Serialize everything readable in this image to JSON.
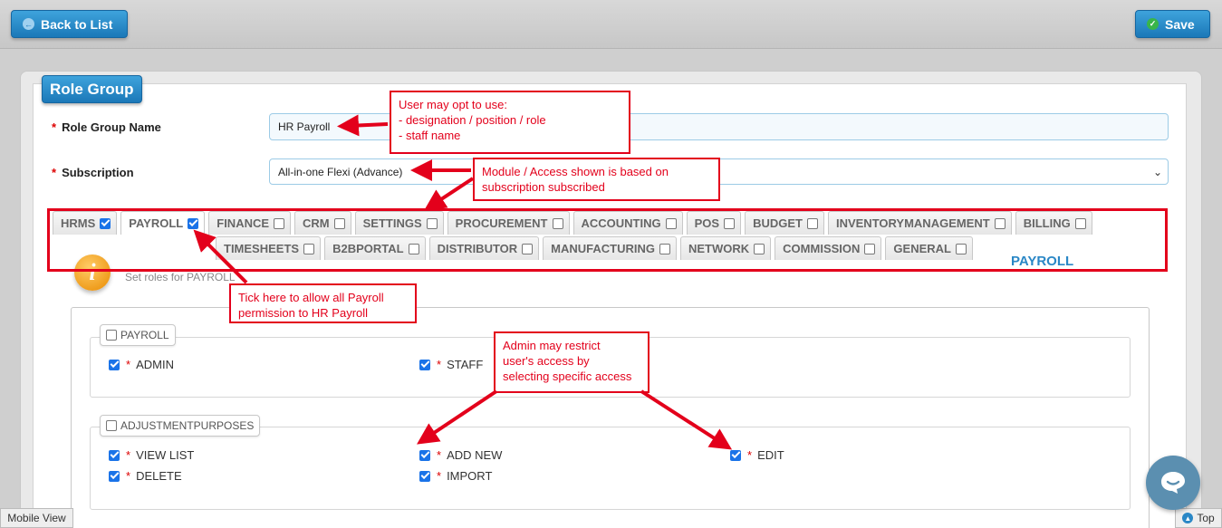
{
  "toolbar": {
    "back_label": "Back to List",
    "save_label": "Save"
  },
  "panel": {
    "title": "Role Group",
    "name_label": "Role Group Name",
    "name_value": "HR Payroll",
    "subscription_label": "Subscription",
    "subscription_value": "All-in-one Flexi (Advance)"
  },
  "tabs_row1": [
    {
      "label": "HRMS",
      "checked": true
    },
    {
      "label": "PAYROLL",
      "checked": true
    },
    {
      "label": "FINANCE",
      "checked": false
    },
    {
      "label": "CRM",
      "checked": false
    },
    {
      "label": "SETTINGS",
      "checked": false
    },
    {
      "label": "PROCUREMENT",
      "checked": false
    },
    {
      "label": "ACCOUNTING",
      "checked": false
    },
    {
      "label": "POS",
      "checked": false
    },
    {
      "label": "BUDGET",
      "checked": false
    },
    {
      "label": "INVENTORYMANAGEMENT",
      "checked": false
    },
    {
      "label": "BILLING",
      "checked": false
    }
  ],
  "tabs_row2": [
    {
      "label": "TIMESHEETS",
      "checked": false
    },
    {
      "label": "B2BPORTAL",
      "checked": false
    },
    {
      "label": "DISTRIBUTOR",
      "checked": false
    },
    {
      "label": "MANUFACTURING",
      "checked": false
    },
    {
      "label": "NETWORK",
      "checked": false
    },
    {
      "label": "COMMISSION",
      "checked": false
    },
    {
      "label": "GENERAL",
      "checked": false
    }
  ],
  "active_tab_title": "PAYROLL",
  "info_text": "Set roles for PAYROLL",
  "groups": [
    {
      "label": "PAYROLL",
      "items": [
        {
          "label": "ADMIN",
          "checked": true
        },
        {
          "label": "STAFF",
          "checked": true
        }
      ]
    },
    {
      "label": "ADJUSTMENTPURPOSES",
      "items": [
        {
          "label": "VIEW LIST",
          "checked": true
        },
        {
          "label": "ADD NEW",
          "checked": true
        },
        {
          "label": "EDIT",
          "checked": true
        },
        {
          "label": "DELETE",
          "checked": true
        },
        {
          "label": "IMPORT",
          "checked": true
        }
      ]
    }
  ],
  "annotations": {
    "note1": "User may opt to use:\n- designation / position / role\n- staff name",
    "note2": "Module / Access shown is based on\nsubscription subscribed",
    "note3": "Tick here to allow all Payroll\npermission to HR Payroll",
    "note4": "Admin may restrict\nuser's access by\nselecting specific access"
  },
  "footer": {
    "mobile_view": "Mobile View",
    "top": "Top"
  },
  "colors": {
    "accent": "#1b78b8",
    "annotation": "#e3001b",
    "tab_title": "#2a87c6"
  }
}
